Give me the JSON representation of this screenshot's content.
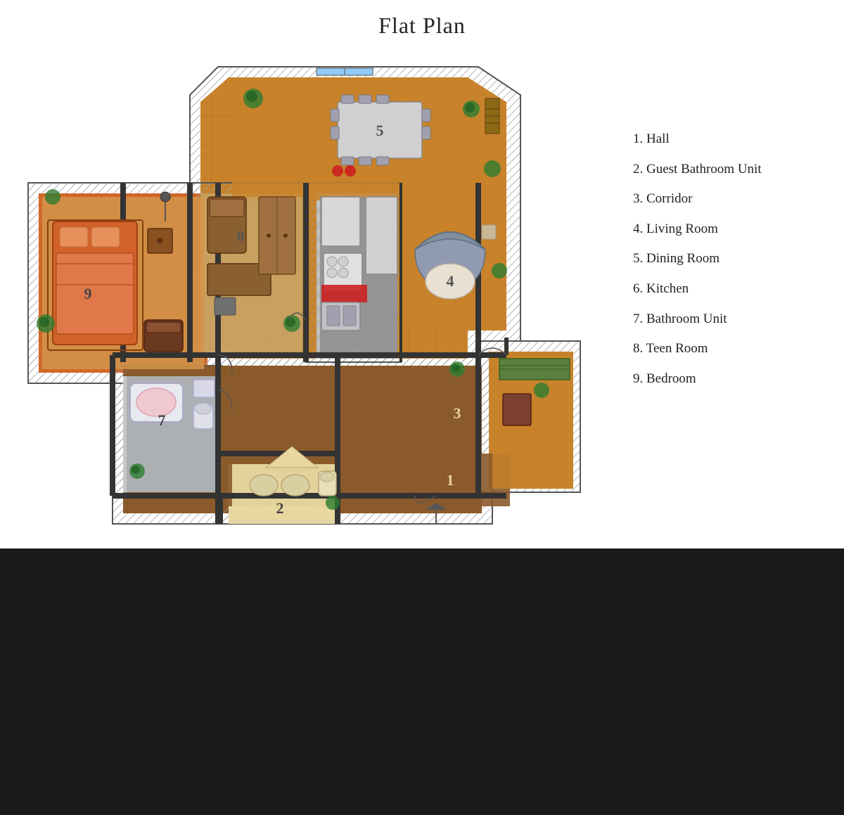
{
  "title": "Flat Plan",
  "legend": {
    "items": [
      {
        "number": "1",
        "label": "Hall"
      },
      {
        "number": "2",
        "label": "Guest Bathroom Unit"
      },
      {
        "number": "3",
        "label": "Corridor"
      },
      {
        "number": "4",
        "label": "Living Room"
      },
      {
        "number": "5",
        "label": "Dining Room"
      },
      {
        "number": "6",
        "label": "Kitchen"
      },
      {
        "number": "7",
        "label": "Bathroom Unit"
      },
      {
        "number": "8",
        "label": "Teen Room"
      },
      {
        "number": "9",
        "label": "Bedroom"
      }
    ]
  },
  "colors": {
    "wall": "#333333",
    "hatch": "#888888",
    "hall_floor": "#8B6914",
    "bedroom_floor": "#C8A060",
    "teen_floor": "#C8A060",
    "kitchen_floor": "#888888",
    "dining_floor": "#C67D30",
    "living_floor": "#C67D30",
    "corridor_floor": "#8B5E20",
    "bathroom_floor": "#AAAAAA",
    "guest_bath_floor": "#E8D8A0",
    "furniture_brown": "#8B4513",
    "furniture_light": "#D2B48C",
    "sofa_color": "#A0522D",
    "plant_green": "#2E7D32"
  }
}
